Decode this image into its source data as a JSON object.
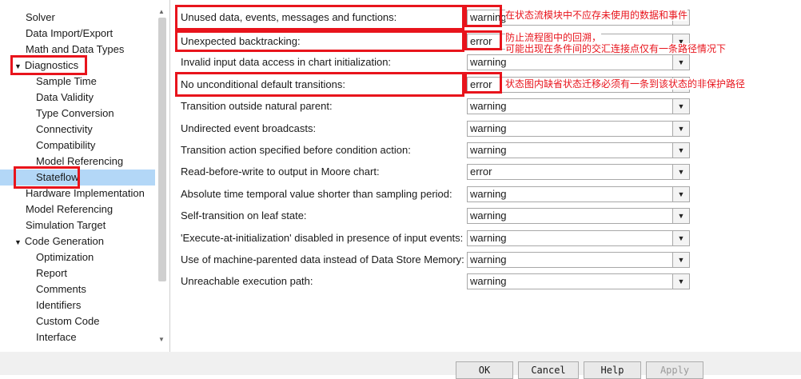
{
  "sidebar": {
    "items": [
      {
        "label": "Solver"
      },
      {
        "label": "Data Import/Export"
      },
      {
        "label": "Math and Data Types"
      },
      {
        "label": "Diagnostics"
      },
      {
        "label": "Sample Time"
      },
      {
        "label": "Data Validity"
      },
      {
        "label": "Type Conversion"
      },
      {
        "label": "Connectivity"
      },
      {
        "label": "Compatibility"
      },
      {
        "label": "Model Referencing"
      },
      {
        "label": "Stateflow"
      },
      {
        "label": "Hardware Implementation"
      },
      {
        "label": "Model Referencing"
      },
      {
        "label": "Simulation Target"
      },
      {
        "label": "Code Generation"
      },
      {
        "label": "Optimization"
      },
      {
        "label": "Report"
      },
      {
        "label": "Comments"
      },
      {
        "label": "Identifiers"
      },
      {
        "label": "Custom Code"
      },
      {
        "label": "Interface"
      }
    ],
    "expand_glyph": "▼"
  },
  "settings": {
    "rows": [
      {
        "label": "Unused data, events, messages and functions:",
        "value": "warning"
      },
      {
        "label": "Unexpected backtracking:",
        "value": "error"
      },
      {
        "label": "Invalid input data access in chart initialization:",
        "value": "warning"
      },
      {
        "label": "No unconditional default transitions:",
        "value": "error"
      },
      {
        "label": "Transition outside natural parent:",
        "value": "warning"
      },
      {
        "label": "Undirected event broadcasts:",
        "value": "warning"
      },
      {
        "label": "Transition action specified before condition action:",
        "value": "warning"
      },
      {
        "label": "Read-before-write to output in Moore chart:",
        "value": "error"
      },
      {
        "label": "Absolute time temporal value shorter than sampling period:",
        "value": "warning"
      },
      {
        "label": "Self-transition on leaf state:",
        "value": "warning"
      },
      {
        "label": "'Execute-at-initialization' disabled in presence of input events:",
        "value": "warning"
      },
      {
        "label": "Use of machine-parented data instead of Data Store Memory:",
        "value": "warning"
      },
      {
        "label": "Unreachable execution path:",
        "value": "warning"
      }
    ],
    "dropdown_glyph": "▼"
  },
  "annotations": {
    "note1": "在状态流模块中不应存未使用的数据和事件",
    "note2_line1": "防止流程图中的回溯，",
    "note2_line2": "可能出现在条件间的交汇连接点仅有一条路径情况下",
    "note3": "状态图内缺省状态迁移必须有一条到该状态的非保护路径",
    "color": "#e8141c"
  },
  "buttons": {
    "ok": "OK",
    "cancel": "Cancel",
    "help": "Help",
    "apply": "Apply"
  }
}
